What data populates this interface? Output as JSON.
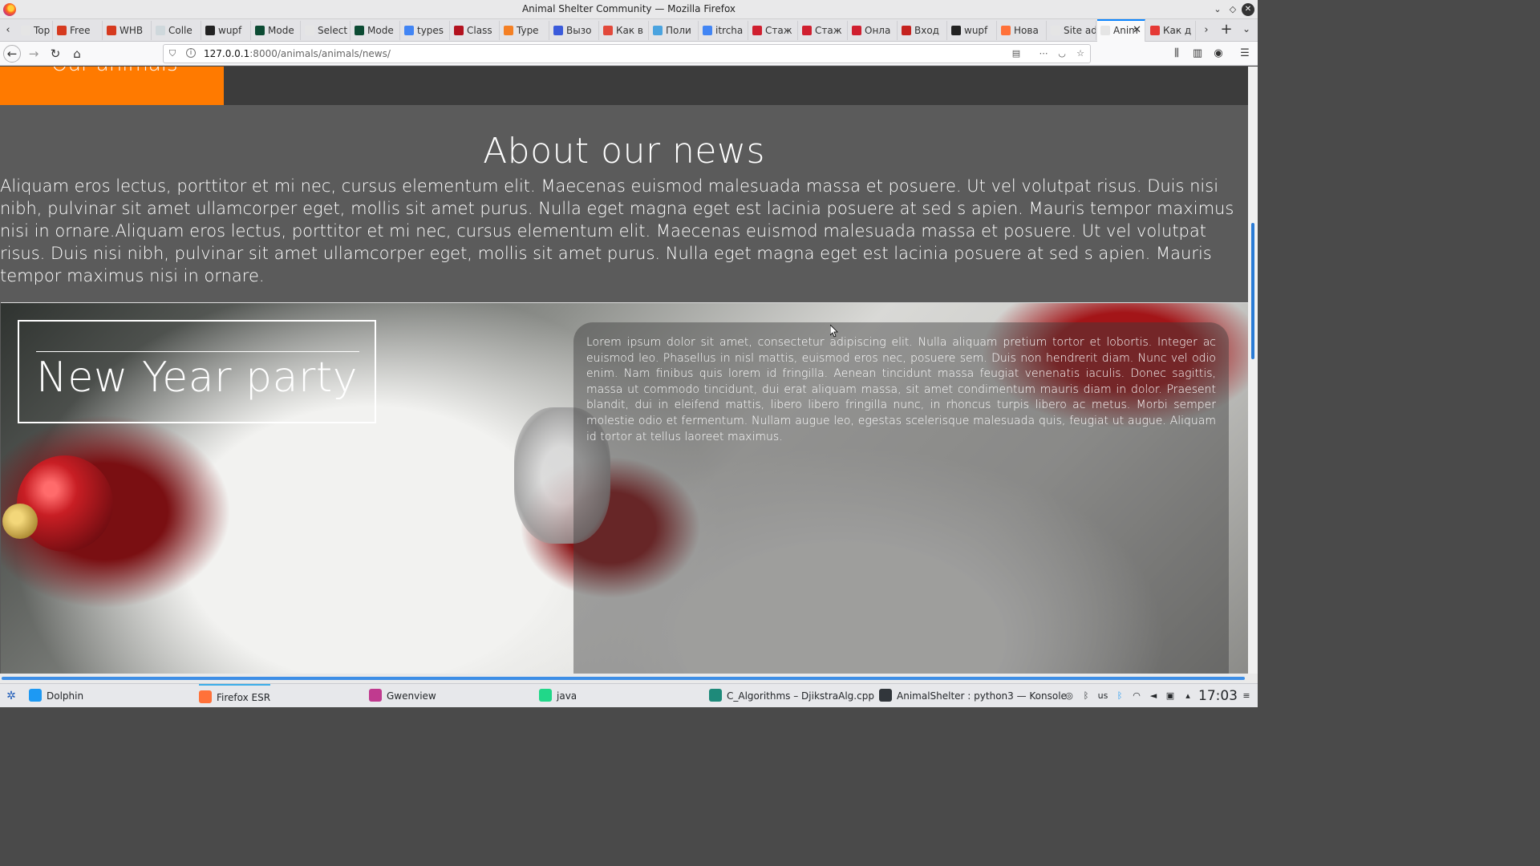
{
  "window": {
    "title": "Animal Shelter Community — Mozilla Firefox"
  },
  "tabs": [
    {
      "label": "Top a",
      "icon_color": "#e5e5e5"
    },
    {
      "label": "Free",
      "icon_color": "#d63a1f"
    },
    {
      "label": "WHB",
      "icon_color": "#d63a1f"
    },
    {
      "label": "Colle",
      "icon_color": "#cfd8dc"
    },
    {
      "label": "wupf",
      "icon_color": "#222222"
    },
    {
      "label": "Mode",
      "icon_color": "#0c4b33"
    },
    {
      "label": "Select ar",
      "icon_color": "#e5e5e5"
    },
    {
      "label": "Mode",
      "icon_color": "#0c4b33"
    },
    {
      "label": "types",
      "icon_color": "#4285f4"
    },
    {
      "label": "Class",
      "icon_color": "#b3121f"
    },
    {
      "label": "Type",
      "icon_color": "#f48024"
    },
    {
      "label": "Вызо",
      "icon_color": "#3b5bdb"
    },
    {
      "label": "Как в",
      "icon_color": "#e2493b"
    },
    {
      "label": "Поли",
      "icon_color": "#4aa3df"
    },
    {
      "label": "itrcha",
      "icon_color": "#4285f4"
    },
    {
      "label": "Стаж",
      "icon_color": "#d01f2f"
    },
    {
      "label": "Стаж",
      "icon_color": "#d01f2f"
    },
    {
      "label": "Онла",
      "icon_color": "#d01f2f"
    },
    {
      "label": "Вход",
      "icon_color": "#c5221f"
    },
    {
      "label": "wupf",
      "icon_color": "#222222"
    },
    {
      "label": "Нова",
      "icon_color": "#ff7139"
    },
    {
      "label": "Site adm",
      "icon_color": "#e5e5e5"
    },
    {
      "label": "Anim",
      "icon_color": "#e5e5e5",
      "active": true
    },
    {
      "label": "Как д",
      "icon_color": "#e53935"
    }
  ],
  "tab_close": "✕",
  "new_tab": "+",
  "url": {
    "host": "127.0.0.1",
    "rest": ":8000/animals/animals/news/"
  },
  "page": {
    "nav_active_label": "Our animals",
    "about_heading": "About our news",
    "about_text": "Aliquam eros lectus, porttitor et mi nec, cursus elementum elit. Maecenas euismod malesuada massa et posuere. Ut vel volutpat risus. Duis nisi nibh, pulvinar sit amet ullamcorper eget, mollis sit amet purus. Nulla eget magna eget est lacinia posuere at sed s apien. Mauris tempor maximus nisi in ornare.Aliquam eros lectus, porttitor et mi nec, cursus elementum elit. Maecenas euismod malesuada massa et posuere. Ut vel volutpat risus. Duis nisi nibh, pulvinar sit amet ullamcorper eget, mollis sit amet purus. Nulla eget magna eget est lacinia posuere at sed s apien. Mauris tempor maximus nisi in ornare.",
    "news_title": "New Year party",
    "news_text": "Lorem ipsum dolor sit amet, consectetur adipiscing elit. Nulla aliquam pretium tortor et lobortis. Integer ac euismod leo. Phasellus in nisl mattis, euismod eros nec, posuere sem. Duis non hendrerit diam. Nunc vel odio enim. Nam finibus quis lorem id fringilla. Aenean tincidunt massa feugiat venenatis iaculis. Donec sagittis, massa ut commodo tincidunt, dui erat aliquam massa, sit amet condimentum mauris diam in dolor. Praesent blandit, dui in eleifend mattis, libero libero fringilla nunc, in rhoncus turpis libero ac metus. Morbi semper molestie odio et fermentum. Nullam augue leo, egestas scelerisque malesuada quis, feugiat ut augue. Aliquam id tortor at tellus laoreet maximus."
  },
  "taskbar": {
    "tasks": [
      {
        "label": "Dolphin",
        "icon_color": "#1d99f3"
      },
      {
        "label": "Firefox ESR",
        "icon_color": "#ff7139"
      },
      {
        "label": "Gwenview",
        "icon_color": "#c03a8f"
      },
      {
        "label": "java",
        "icon_color": "#21d789"
      },
      {
        "label": "C_Algorithms – DjikstraAlg.cpp",
        "icon_color": "#1e8a7a"
      },
      {
        "label": "AnimalShelter : python3 — Konsole",
        "icon_color": "#31363b"
      }
    ],
    "keyboard_layout": "us",
    "clock": "17:03"
  },
  "colors": {
    "accent_orange": "#ff7a00",
    "firefox_accent": "#0a84ff",
    "kde_accent": "#3daee9"
  }
}
